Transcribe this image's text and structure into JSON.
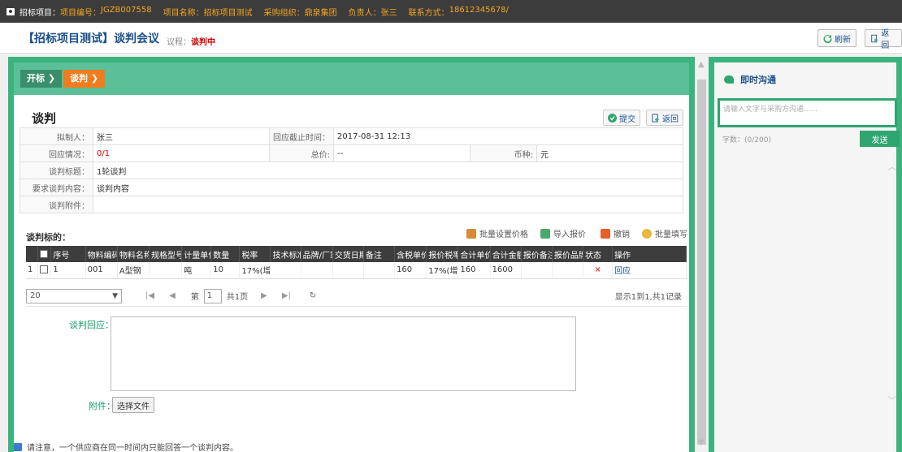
{
  "topbar": {
    "project_label": "招标项目：",
    "project_no_label": "项目编号：",
    "project_no": "JGZB007558",
    "project_name_label": "项目名称：",
    "project_name": "招标项目测试",
    "org_label": "采购组织：",
    "org": "鼎泉集团",
    "owner_label": "负责人：",
    "owner": "张三",
    "contact_label": "联系方式：",
    "contact": "18612345678/"
  },
  "header": {
    "title": "【招标项目测试】谈判会议",
    "stage_label": "议程：",
    "stage_value": "谈判中",
    "refresh_label": "刷新",
    "back_label": "返回"
  },
  "steps": [
    "开标 ❯",
    "谈判 ❯"
  ],
  "section": {
    "title": "谈判",
    "submit_label": "提交",
    "back_label": "返回"
  },
  "info": {
    "drafter_label": "拟制人：",
    "drafter": "张三",
    "deadline_label": "回应截止时间：",
    "deadline": "2017-08-31 12:13",
    "response_label": "回应情况：",
    "response": "0/1",
    "total_label": "总价:",
    "total": "--",
    "currency_label": "币种:",
    "currency": "元",
    "topic_label": "谈判标题：",
    "topic": "1轮谈判",
    "content_label": "要求谈判内容：",
    "content": "谈判内容",
    "attachment_label": "谈判附件："
  },
  "items": {
    "title": "谈判标的：",
    "tools": [
      "批量设置价格",
      "导入报价",
      "撤销",
      "批量填写"
    ],
    "columns": [
      "",
      "",
      "序号",
      "物料编码",
      "物料名称",
      "规格型号",
      "计量单位",
      "数量",
      "税率",
      "技术标准",
      "品牌/厂家",
      "交货日期",
      "备注",
      "含税单价",
      "报价税率",
      "合计单价",
      "合计金额",
      "报价备注",
      "报价品牌",
      "状态",
      "操作"
    ],
    "rows": [
      [
        "1",
        "",
        "1",
        "001",
        "A型钢",
        "",
        "吨",
        "10",
        "17%(增",
        "",
        "",
        "",
        "",
        "160",
        "17%(增",
        "160",
        "1600",
        "",
        "",
        "×",
        "回应"
      ]
    ]
  },
  "pager": {
    "page_size": "20",
    "page_label": "第",
    "page": "1",
    "total_pages": "共1页",
    "summary": "显示1到1,共1记录"
  },
  "reply": {
    "label": "谈判回应：",
    "attach_label": "附件：",
    "choose_file": "选择文件"
  },
  "notice": "请注意，一个供应商在同一时间内只能回答一个谈判内容。",
  "chat": {
    "title": "即时沟通",
    "placeholder": "请输入文字与采购方沟通......",
    "count": "字数：(0/200)",
    "send": "发送"
  },
  "colors": {
    "accent_green": "#3bb37f",
    "step_orange": "#f07c1e",
    "dark_bar": "#3c3c3c",
    "warn_red": "#d00"
  }
}
